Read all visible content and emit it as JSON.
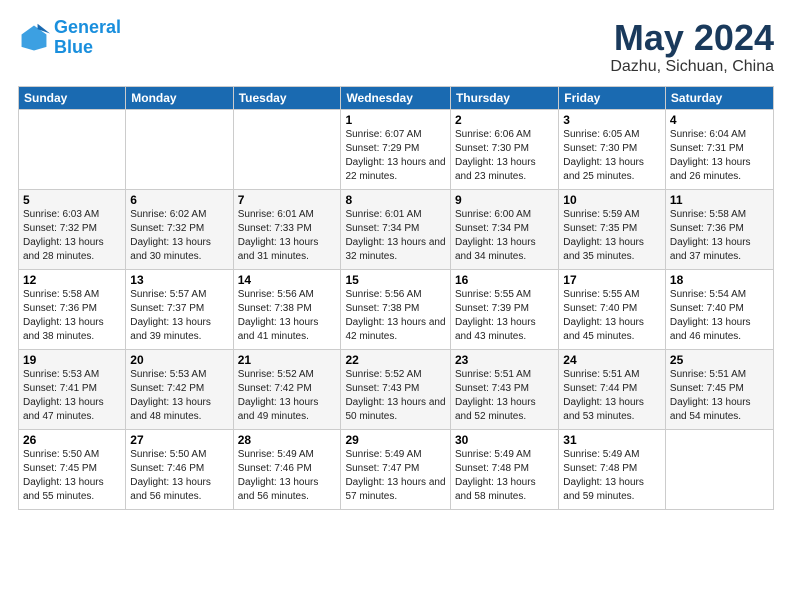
{
  "logo": {
    "line1": "General",
    "line2": "Blue"
  },
  "header": {
    "title": "May 2024",
    "subtitle": "Dazhu, Sichuan, China"
  },
  "weekdays": [
    "Sunday",
    "Monday",
    "Tuesday",
    "Wednesday",
    "Thursday",
    "Friday",
    "Saturday"
  ],
  "weeks": [
    [
      {
        "day": "",
        "sunrise": "",
        "sunset": "",
        "daylight": ""
      },
      {
        "day": "",
        "sunrise": "",
        "sunset": "",
        "daylight": ""
      },
      {
        "day": "",
        "sunrise": "",
        "sunset": "",
        "daylight": ""
      },
      {
        "day": "1",
        "sunrise": "Sunrise: 6:07 AM",
        "sunset": "Sunset: 7:29 PM",
        "daylight": "Daylight: 13 hours and 22 minutes."
      },
      {
        "day": "2",
        "sunrise": "Sunrise: 6:06 AM",
        "sunset": "Sunset: 7:30 PM",
        "daylight": "Daylight: 13 hours and 23 minutes."
      },
      {
        "day": "3",
        "sunrise": "Sunrise: 6:05 AM",
        "sunset": "Sunset: 7:30 PM",
        "daylight": "Daylight: 13 hours and 25 minutes."
      },
      {
        "day": "4",
        "sunrise": "Sunrise: 6:04 AM",
        "sunset": "Sunset: 7:31 PM",
        "daylight": "Daylight: 13 hours and 26 minutes."
      }
    ],
    [
      {
        "day": "5",
        "sunrise": "Sunrise: 6:03 AM",
        "sunset": "Sunset: 7:32 PM",
        "daylight": "Daylight: 13 hours and 28 minutes."
      },
      {
        "day": "6",
        "sunrise": "Sunrise: 6:02 AM",
        "sunset": "Sunset: 7:32 PM",
        "daylight": "Daylight: 13 hours and 30 minutes."
      },
      {
        "day": "7",
        "sunrise": "Sunrise: 6:01 AM",
        "sunset": "Sunset: 7:33 PM",
        "daylight": "Daylight: 13 hours and 31 minutes."
      },
      {
        "day": "8",
        "sunrise": "Sunrise: 6:01 AM",
        "sunset": "Sunset: 7:34 PM",
        "daylight": "Daylight: 13 hours and 32 minutes."
      },
      {
        "day": "9",
        "sunrise": "Sunrise: 6:00 AM",
        "sunset": "Sunset: 7:34 PM",
        "daylight": "Daylight: 13 hours and 34 minutes."
      },
      {
        "day": "10",
        "sunrise": "Sunrise: 5:59 AM",
        "sunset": "Sunset: 7:35 PM",
        "daylight": "Daylight: 13 hours and 35 minutes."
      },
      {
        "day": "11",
        "sunrise": "Sunrise: 5:58 AM",
        "sunset": "Sunset: 7:36 PM",
        "daylight": "Daylight: 13 hours and 37 minutes."
      }
    ],
    [
      {
        "day": "12",
        "sunrise": "Sunrise: 5:58 AM",
        "sunset": "Sunset: 7:36 PM",
        "daylight": "Daylight: 13 hours and 38 minutes."
      },
      {
        "day": "13",
        "sunrise": "Sunrise: 5:57 AM",
        "sunset": "Sunset: 7:37 PM",
        "daylight": "Daylight: 13 hours and 39 minutes."
      },
      {
        "day": "14",
        "sunrise": "Sunrise: 5:56 AM",
        "sunset": "Sunset: 7:38 PM",
        "daylight": "Daylight: 13 hours and 41 minutes."
      },
      {
        "day": "15",
        "sunrise": "Sunrise: 5:56 AM",
        "sunset": "Sunset: 7:38 PM",
        "daylight": "Daylight: 13 hours and 42 minutes."
      },
      {
        "day": "16",
        "sunrise": "Sunrise: 5:55 AM",
        "sunset": "Sunset: 7:39 PM",
        "daylight": "Daylight: 13 hours and 43 minutes."
      },
      {
        "day": "17",
        "sunrise": "Sunrise: 5:55 AM",
        "sunset": "Sunset: 7:40 PM",
        "daylight": "Daylight: 13 hours and 45 minutes."
      },
      {
        "day": "18",
        "sunrise": "Sunrise: 5:54 AM",
        "sunset": "Sunset: 7:40 PM",
        "daylight": "Daylight: 13 hours and 46 minutes."
      }
    ],
    [
      {
        "day": "19",
        "sunrise": "Sunrise: 5:53 AM",
        "sunset": "Sunset: 7:41 PM",
        "daylight": "Daylight: 13 hours and 47 minutes."
      },
      {
        "day": "20",
        "sunrise": "Sunrise: 5:53 AM",
        "sunset": "Sunset: 7:42 PM",
        "daylight": "Daylight: 13 hours and 48 minutes."
      },
      {
        "day": "21",
        "sunrise": "Sunrise: 5:52 AM",
        "sunset": "Sunset: 7:42 PM",
        "daylight": "Daylight: 13 hours and 49 minutes."
      },
      {
        "day": "22",
        "sunrise": "Sunrise: 5:52 AM",
        "sunset": "Sunset: 7:43 PM",
        "daylight": "Daylight: 13 hours and 50 minutes."
      },
      {
        "day": "23",
        "sunrise": "Sunrise: 5:51 AM",
        "sunset": "Sunset: 7:43 PM",
        "daylight": "Daylight: 13 hours and 52 minutes."
      },
      {
        "day": "24",
        "sunrise": "Sunrise: 5:51 AM",
        "sunset": "Sunset: 7:44 PM",
        "daylight": "Daylight: 13 hours and 53 minutes."
      },
      {
        "day": "25",
        "sunrise": "Sunrise: 5:51 AM",
        "sunset": "Sunset: 7:45 PM",
        "daylight": "Daylight: 13 hours and 54 minutes."
      }
    ],
    [
      {
        "day": "26",
        "sunrise": "Sunrise: 5:50 AM",
        "sunset": "Sunset: 7:45 PM",
        "daylight": "Daylight: 13 hours and 55 minutes."
      },
      {
        "day": "27",
        "sunrise": "Sunrise: 5:50 AM",
        "sunset": "Sunset: 7:46 PM",
        "daylight": "Daylight: 13 hours and 56 minutes."
      },
      {
        "day": "28",
        "sunrise": "Sunrise: 5:49 AM",
        "sunset": "Sunset: 7:46 PM",
        "daylight": "Daylight: 13 hours and 56 minutes."
      },
      {
        "day": "29",
        "sunrise": "Sunrise: 5:49 AM",
        "sunset": "Sunset: 7:47 PM",
        "daylight": "Daylight: 13 hours and 57 minutes."
      },
      {
        "day": "30",
        "sunrise": "Sunrise: 5:49 AM",
        "sunset": "Sunset: 7:48 PM",
        "daylight": "Daylight: 13 hours and 58 minutes."
      },
      {
        "day": "31",
        "sunrise": "Sunrise: 5:49 AM",
        "sunset": "Sunset: 7:48 PM",
        "daylight": "Daylight: 13 hours and 59 minutes."
      },
      {
        "day": "",
        "sunrise": "",
        "sunset": "",
        "daylight": ""
      }
    ]
  ]
}
